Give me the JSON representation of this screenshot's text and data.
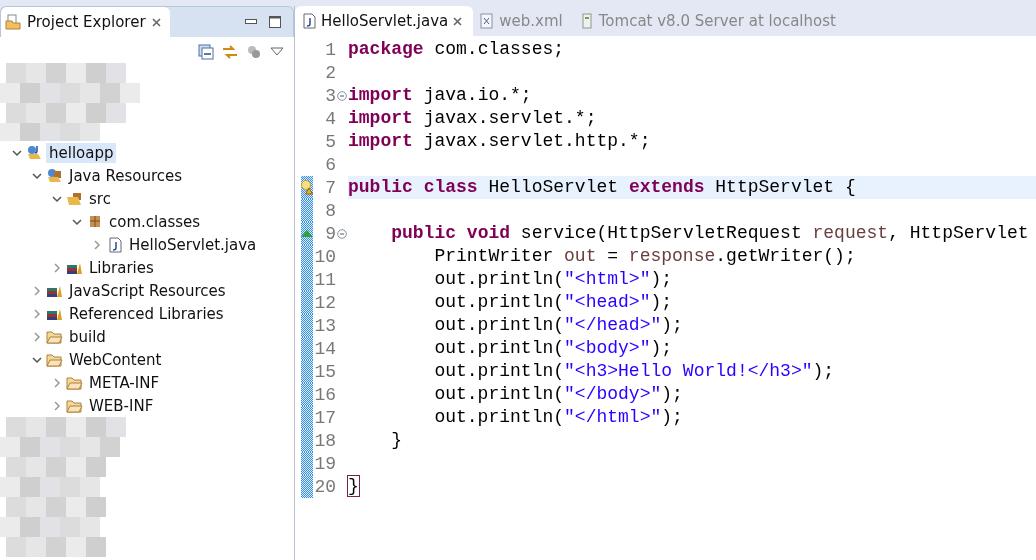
{
  "explorer": {
    "tab": {
      "label": "Project Explorer",
      "selected": true
    },
    "tree": [
      {
        "label": "helloapp",
        "kind": "project",
        "expanded": true,
        "selected": true,
        "children": [
          {
            "label": "Java Resources",
            "kind": "resources",
            "expanded": true,
            "selected": false,
            "children": [
              {
                "label": "src",
                "kind": "source",
                "expanded": true,
                "selected": false,
                "children": [
                  {
                    "label": "com.classes",
                    "kind": "package",
                    "expanded": true,
                    "selected": false,
                    "children": [
                      {
                        "label": "HelloServlet.java",
                        "kind": "file",
                        "expanded": false,
                        "selected": false
                      }
                    ]
                  }
                ]
              },
              {
                "label": "Libraries",
                "kind": "library",
                "expanded": false,
                "selected": false
              }
            ]
          },
          {
            "label": "JavaScript Resources",
            "kind": "library",
            "expanded": false,
            "selected": false
          },
          {
            "label": "Referenced Libraries",
            "kind": "library",
            "expanded": false,
            "selected": false
          },
          {
            "label": "build",
            "kind": "folder",
            "expanded": false,
            "selected": false
          },
          {
            "label": "WebContent",
            "kind": "folder",
            "expanded": true,
            "selected": false,
            "children": [
              {
                "label": "META-INF",
                "kind": "folder",
                "expanded": false,
                "selected": false
              },
              {
                "label": "WEB-INF",
                "kind": "folder",
                "expanded": false,
                "selected": false
              }
            ]
          }
        ]
      }
    ]
  },
  "editor": {
    "tabs": [
      {
        "label": "HelloServlet.java",
        "kind": "java",
        "selected": true
      },
      {
        "label": "web.xml",
        "kind": "xml",
        "selected": false
      },
      {
        "label": "Tomcat v8.0 Server at localhost",
        "kind": "server",
        "selected": false
      }
    ],
    "lines": [
      {
        "number": "1",
        "kind": "plain",
        "fold": false,
        "current": false,
        "changed": false,
        "tokens": [
          {
            "kind": "keyword",
            "text": "package "
          },
          {
            "kind": "plain",
            "text": "com.classes;"
          }
        ]
      },
      {
        "number": "2",
        "kind": "plain",
        "fold": false,
        "current": false,
        "changed": false
      },
      {
        "number": "3",
        "kind": "plain",
        "fold": true,
        "current": false,
        "changed": false,
        "tokens": [
          {
            "kind": "keyword",
            "text": "import "
          },
          {
            "kind": "plain",
            "text": "java.io.*;"
          }
        ]
      },
      {
        "number": "4",
        "kind": "plain",
        "fold": false,
        "current": false,
        "changed": false,
        "tokens": [
          {
            "kind": "keyword",
            "text": "import "
          },
          {
            "kind": "plain",
            "text": "javax.servlet.*;"
          }
        ]
      },
      {
        "number": "5",
        "kind": "plain",
        "fold": false,
        "current": false,
        "changed": false,
        "tokens": [
          {
            "kind": "keyword",
            "text": "import "
          },
          {
            "kind": "plain",
            "text": "javax.servlet.http.*;"
          }
        ]
      },
      {
        "number": "6",
        "kind": "plain",
        "fold": false,
        "current": false,
        "changed": false
      },
      {
        "number": "7",
        "kind": "warning",
        "fold": false,
        "current": true,
        "changed": true,
        "tokens": [
          {
            "kind": "keyword",
            "text": "public "
          },
          {
            "kind": "keyword",
            "text": "class"
          },
          {
            "kind": "plain",
            "text": " HelloServlet "
          },
          {
            "kind": "keyword",
            "text": "extends"
          },
          {
            "kind": "plain",
            "text": " HttpServlet {"
          }
        ]
      },
      {
        "number": "8",
        "kind": "plain",
        "fold": false,
        "current": false,
        "changed": true
      },
      {
        "number": "9",
        "kind": "override",
        "fold": true,
        "current": false,
        "changed": true,
        "tokens": [
          {
            "kind": "keyword",
            "text": "    public "
          },
          {
            "kind": "keyword",
            "text": "void"
          },
          {
            "kind": "plain",
            "text": " service(HttpServletRequest "
          },
          {
            "kind": "variable",
            "text": "request"
          },
          {
            "kind": "plain",
            "text": ", HttpServlet"
          }
        ]
      },
      {
        "number": "10",
        "kind": "plain",
        "fold": false,
        "current": false,
        "changed": true,
        "tokens": [
          {
            "kind": "plain",
            "text": "        PrintWriter "
          },
          {
            "kind": "variable",
            "text": "out"
          },
          {
            "kind": "plain",
            "text": " = "
          },
          {
            "kind": "variable",
            "text": "response"
          },
          {
            "kind": "plain",
            "text": ".getWriter();"
          }
        ]
      },
      {
        "number": "11",
        "kind": "plain",
        "fold": false,
        "current": false,
        "changed": true,
        "tokens": [
          {
            "kind": "plain",
            "text": "        out.println("
          },
          {
            "kind": "string",
            "text": "\"<html>\""
          },
          {
            "kind": "plain",
            "text": ");"
          }
        ]
      },
      {
        "number": "12",
        "kind": "plain",
        "fold": false,
        "current": false,
        "changed": true,
        "tokens": [
          {
            "kind": "plain",
            "text": "        out.println("
          },
          {
            "kind": "string",
            "text": "\"<head>\""
          },
          {
            "kind": "plain",
            "text": ");"
          }
        ]
      },
      {
        "number": "13",
        "kind": "plain",
        "fold": false,
        "current": false,
        "changed": true,
        "tokens": [
          {
            "kind": "plain",
            "text": "        out.println("
          },
          {
            "kind": "string",
            "text": "\"</head>\""
          },
          {
            "kind": "plain",
            "text": ");"
          }
        ]
      },
      {
        "number": "14",
        "kind": "plain",
        "fold": false,
        "current": false,
        "changed": true,
        "tokens": [
          {
            "kind": "plain",
            "text": "        out.println("
          },
          {
            "kind": "string",
            "text": "\"<body>\""
          },
          {
            "kind": "plain",
            "text": ");"
          }
        ]
      },
      {
        "number": "15",
        "kind": "plain",
        "fold": false,
        "current": false,
        "changed": true,
        "tokens": [
          {
            "kind": "plain",
            "text": "        out.println("
          },
          {
            "kind": "string",
            "text": "\"<h3>Hello World!</h3>\""
          },
          {
            "kind": "plain",
            "text": ");"
          }
        ]
      },
      {
        "number": "16",
        "kind": "plain",
        "fold": false,
        "current": false,
        "changed": true,
        "tokens": [
          {
            "kind": "plain",
            "text": "        out.println("
          },
          {
            "kind": "string",
            "text": "\"</body>\""
          },
          {
            "kind": "plain",
            "text": ");"
          }
        ]
      },
      {
        "number": "17",
        "kind": "plain",
        "fold": false,
        "current": false,
        "changed": true,
        "tokens": [
          {
            "kind": "plain",
            "text": "        out.println("
          },
          {
            "kind": "string",
            "text": "\"</html>\""
          },
          {
            "kind": "plain",
            "text": ");"
          }
        ]
      },
      {
        "number": "18",
        "kind": "plain",
        "fold": false,
        "current": false,
        "changed": true,
        "tokens": [
          {
            "kind": "plain",
            "text": "    }"
          }
        ]
      },
      {
        "number": "19",
        "kind": "plain",
        "fold": false,
        "current": false,
        "changed": true
      },
      {
        "number": "20",
        "kind": "plain",
        "fold": false,
        "current": false,
        "changed": true,
        "tokens": [
          {
            "kind": "bracket",
            "text": "}"
          }
        ]
      }
    ]
  }
}
